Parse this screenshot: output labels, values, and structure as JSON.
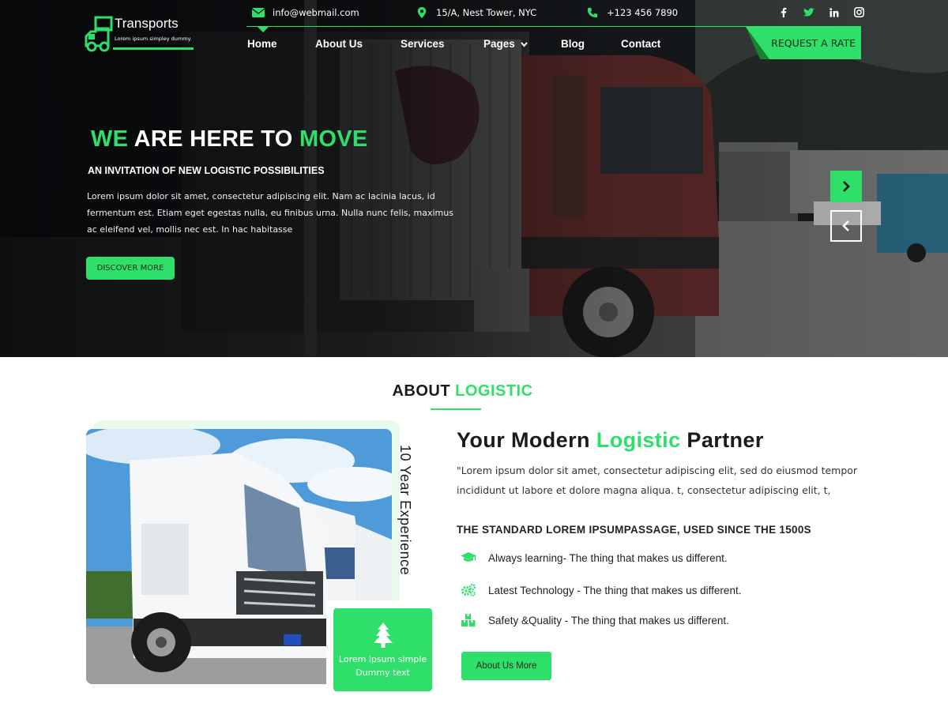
{
  "brand": {
    "name": "Transports",
    "tagline": "Lorem ipsum simpley dummy.",
    "accent": "#2ee06a"
  },
  "topbar": {
    "email": "info@webmail.com",
    "address": "15/A, Nest Tower, NYC",
    "phone": "+123 456 7890",
    "email_icon": "envelope-icon",
    "address_icon": "map-marker-icon",
    "phone_icon": "phone-icon",
    "social": [
      "facebook-icon",
      "twitter-icon",
      "linkedin-icon",
      "instagram-icon"
    ]
  },
  "nav": {
    "items": [
      "Home",
      "About Us",
      "Services",
      "Pages",
      "Blog",
      "Contact"
    ],
    "active": "Home",
    "request_label": "REQUEST A RATE"
  },
  "hero": {
    "title_we": "WE",
    "title_mid": " ARE HERE TO ",
    "title_move": "MOVE",
    "subtitle": "AN INVITATION OF NEW LOGISTIC POSSIBILITIES",
    "text": "Lorem ipsum dolor sit amet, consectetur adipiscing elit. Nam ac lacinia lacus, id fermentum est. Etiam eget egestas nulla, eu finibus urna. Nulla nunc felis, maximus ac eleifend vel, mollis nec est. In hac habitasse",
    "cta": "DISCOVER MORE"
  },
  "about": {
    "title_a": "ABOUT ",
    "title_b": "LOGISTIC",
    "experience": "10 Year Experience",
    "badge_text": "Lorem ipsum simple Dummy text",
    "partner_a": "Your Modern ",
    "partner_b": "Logistic",
    "partner_c": " Partner",
    "paragraph": "\"Lorem ipsum dolor sit amet, consectetur adipiscing elit, sed do eiusmod tempor incididunt ut labore et dolore magna aliqua. t, consectetur adipiscing elit, t,",
    "standard": "THE STANDARD LOREM IPSUMPASSAGE, USED SINCE THE 1500S",
    "features": [
      {
        "icon": "graduation-cap-icon",
        "text": "Always learning- The thing that makes us different."
      },
      {
        "icon": "gears-icon",
        "text": "Latest Technology - The thing that makes us different."
      },
      {
        "icon": "boxes-icon",
        "text": "Safety &Quality - The thing that makes us different."
      }
    ],
    "button": "About Us More"
  }
}
